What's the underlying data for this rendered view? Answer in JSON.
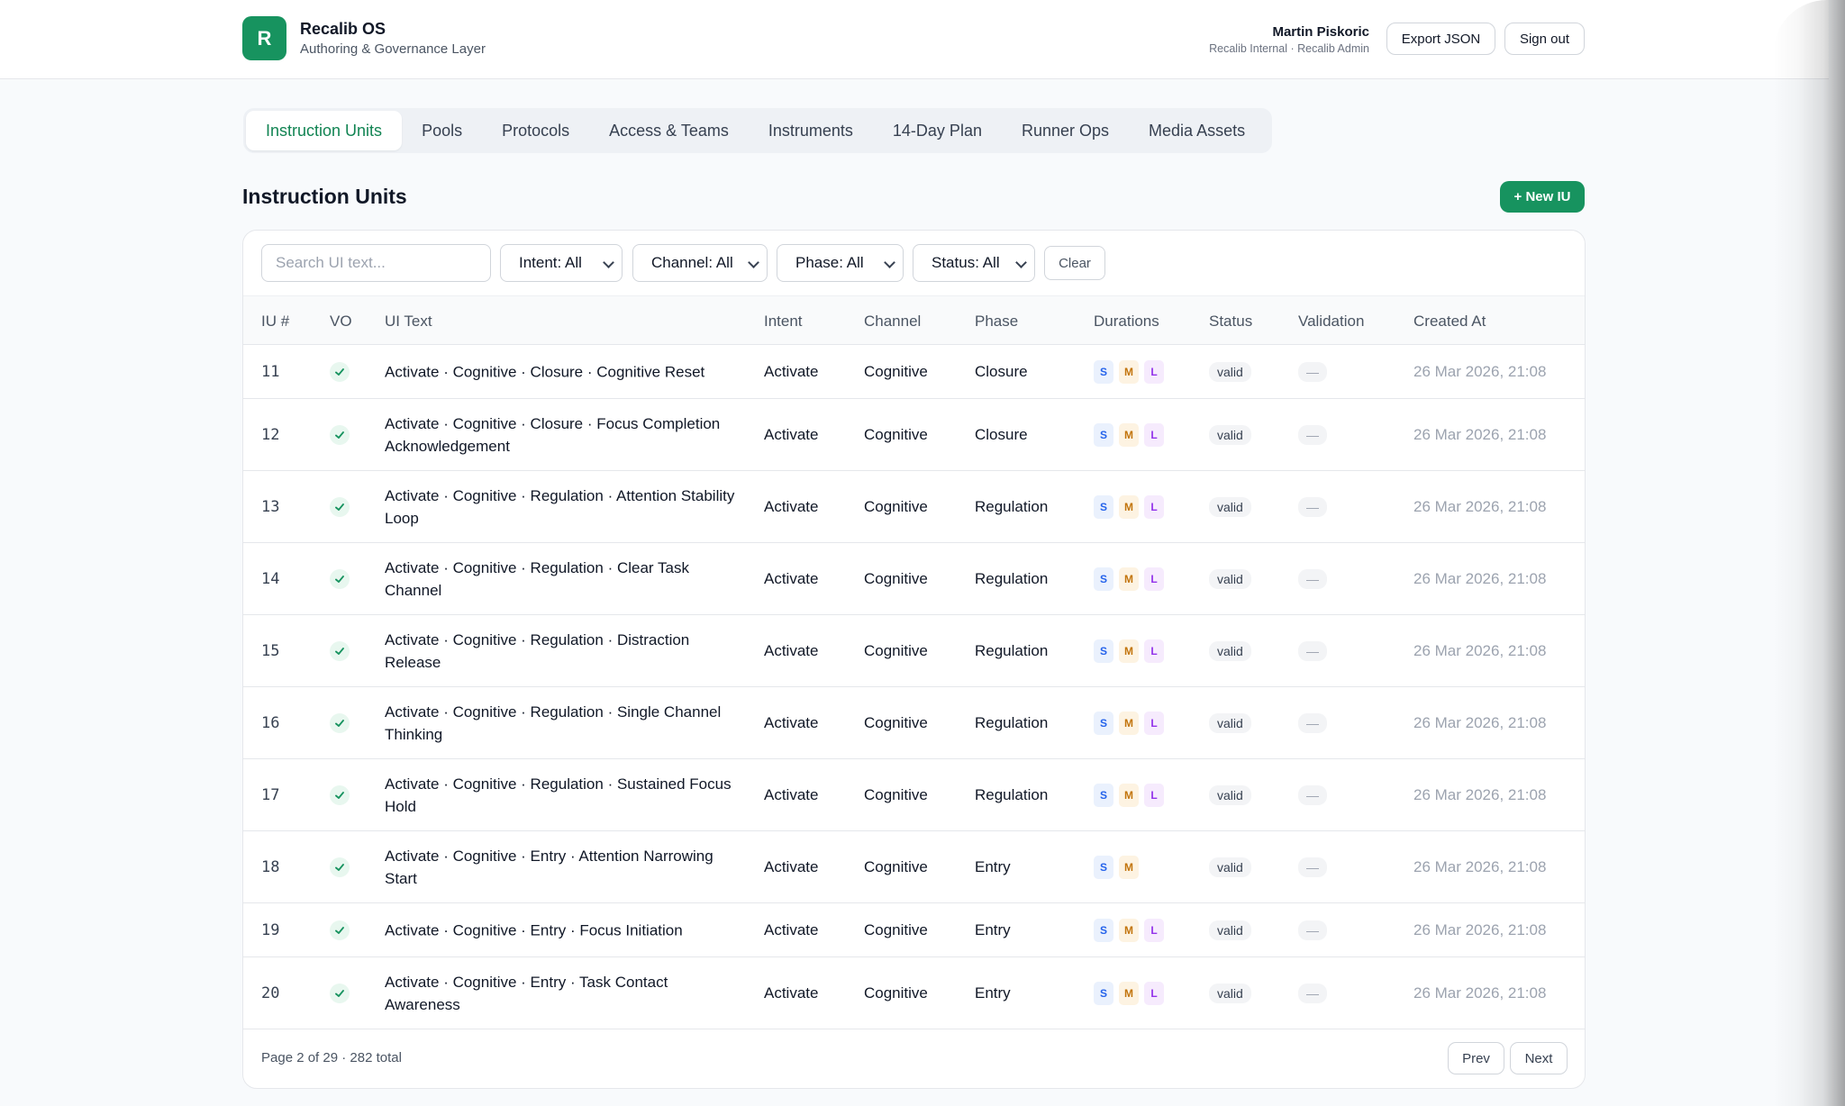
{
  "header": {
    "logo_letter": "R",
    "app_title": "Recalib OS",
    "app_subtitle": "Authoring & Governance Layer",
    "user_name": "Martin Piskoric",
    "user_meta": "Recalib Internal · Recalib Admin",
    "export_label": "Export JSON",
    "signout_label": "Sign out"
  },
  "tabs": [
    {
      "label": "Instruction Units",
      "active": true
    },
    {
      "label": "Pools",
      "active": false
    },
    {
      "label": "Protocols",
      "active": false
    },
    {
      "label": "Access & Teams",
      "active": false
    },
    {
      "label": "Instruments",
      "active": false
    },
    {
      "label": "14-Day Plan",
      "active": false
    },
    {
      "label": "Runner Ops",
      "active": false
    },
    {
      "label": "Media Assets",
      "active": false
    }
  ],
  "section": {
    "title": "Instruction Units",
    "new_label": "+ New IU"
  },
  "filters": {
    "search_placeholder": "Search UI text...",
    "search_value": "",
    "intent": "Intent: All",
    "channel": "Channel: All",
    "phase": "Phase: All",
    "status": "Status: All",
    "clear_label": "Clear"
  },
  "table": {
    "columns": [
      "IU #",
      "VO",
      "UI Text",
      "Intent",
      "Channel",
      "Phase",
      "Durations",
      "Status",
      "Validation",
      "Created At"
    ],
    "rows": [
      {
        "id": "11",
        "vo": true,
        "text": "Activate · Cognitive · Closure · Cognitive Reset",
        "intent": "Activate",
        "channel": "Cognitive",
        "phase": "Closure",
        "durations": [
          "S",
          "M",
          "L"
        ],
        "status": "valid",
        "validation": "—",
        "created": "26 Mar 2026, 21:08"
      },
      {
        "id": "12",
        "vo": true,
        "text": "Activate · Cognitive · Closure · Focus Completion Acknowledgement",
        "intent": "Activate",
        "channel": "Cognitive",
        "phase": "Closure",
        "durations": [
          "S",
          "M",
          "L"
        ],
        "status": "valid",
        "validation": "—",
        "created": "26 Mar 2026, 21:08"
      },
      {
        "id": "13",
        "vo": true,
        "text": "Activate · Cognitive · Regulation · Attention Stability Loop",
        "intent": "Activate",
        "channel": "Cognitive",
        "phase": "Regulation",
        "durations": [
          "S",
          "M",
          "L"
        ],
        "status": "valid",
        "validation": "—",
        "created": "26 Mar 2026, 21:08"
      },
      {
        "id": "14",
        "vo": true,
        "text": "Activate · Cognitive · Regulation · Clear Task Channel",
        "intent": "Activate",
        "channel": "Cognitive",
        "phase": "Regulation",
        "durations": [
          "S",
          "M",
          "L"
        ],
        "status": "valid",
        "validation": "—",
        "created": "26 Mar 2026, 21:08"
      },
      {
        "id": "15",
        "vo": true,
        "text": "Activate · Cognitive · Regulation · Distraction Release",
        "intent": "Activate",
        "channel": "Cognitive",
        "phase": "Regulation",
        "durations": [
          "S",
          "M",
          "L"
        ],
        "status": "valid",
        "validation": "—",
        "created": "26 Mar 2026, 21:08"
      },
      {
        "id": "16",
        "vo": true,
        "text": "Activate · Cognitive · Regulation · Single Channel Thinking",
        "intent": "Activate",
        "channel": "Cognitive",
        "phase": "Regulation",
        "durations": [
          "S",
          "M",
          "L"
        ],
        "status": "valid",
        "validation": "—",
        "created": "26 Mar 2026, 21:08"
      },
      {
        "id": "17",
        "vo": true,
        "text": "Activate · Cognitive · Regulation · Sustained Focus Hold",
        "intent": "Activate",
        "channel": "Cognitive",
        "phase": "Regulation",
        "durations": [
          "S",
          "M",
          "L"
        ],
        "status": "valid",
        "validation": "—",
        "created": "26 Mar 2026, 21:08"
      },
      {
        "id": "18",
        "vo": true,
        "text": "Activate · Cognitive · Entry · Attention Narrowing Start",
        "intent": "Activate",
        "channel": "Cognitive",
        "phase": "Entry",
        "durations": [
          "S",
          "M"
        ],
        "status": "valid",
        "validation": "—",
        "created": "26 Mar 2026, 21:08"
      },
      {
        "id": "19",
        "vo": true,
        "text": "Activate · Cognitive · Entry · Focus Initiation",
        "intent": "Activate",
        "channel": "Cognitive",
        "phase": "Entry",
        "durations": [
          "S",
          "M",
          "L"
        ],
        "status": "valid",
        "validation": "—",
        "created": "26 Mar 2026, 21:08"
      },
      {
        "id": "20",
        "vo": true,
        "text": "Activate · Cognitive · Entry · Task Contact Awareness",
        "intent": "Activate",
        "channel": "Cognitive",
        "phase": "Entry",
        "durations": [
          "S",
          "M",
          "L"
        ],
        "status": "valid",
        "validation": "—",
        "created": "26 Mar 2026, 21:08"
      }
    ]
  },
  "pagination": {
    "summary": "Page 2 of 29 · 282 total",
    "prev_label": "Prev",
    "next_label": "Next"
  },
  "colors": {
    "accent": "#17935f",
    "active_tab_text": "#128453"
  }
}
